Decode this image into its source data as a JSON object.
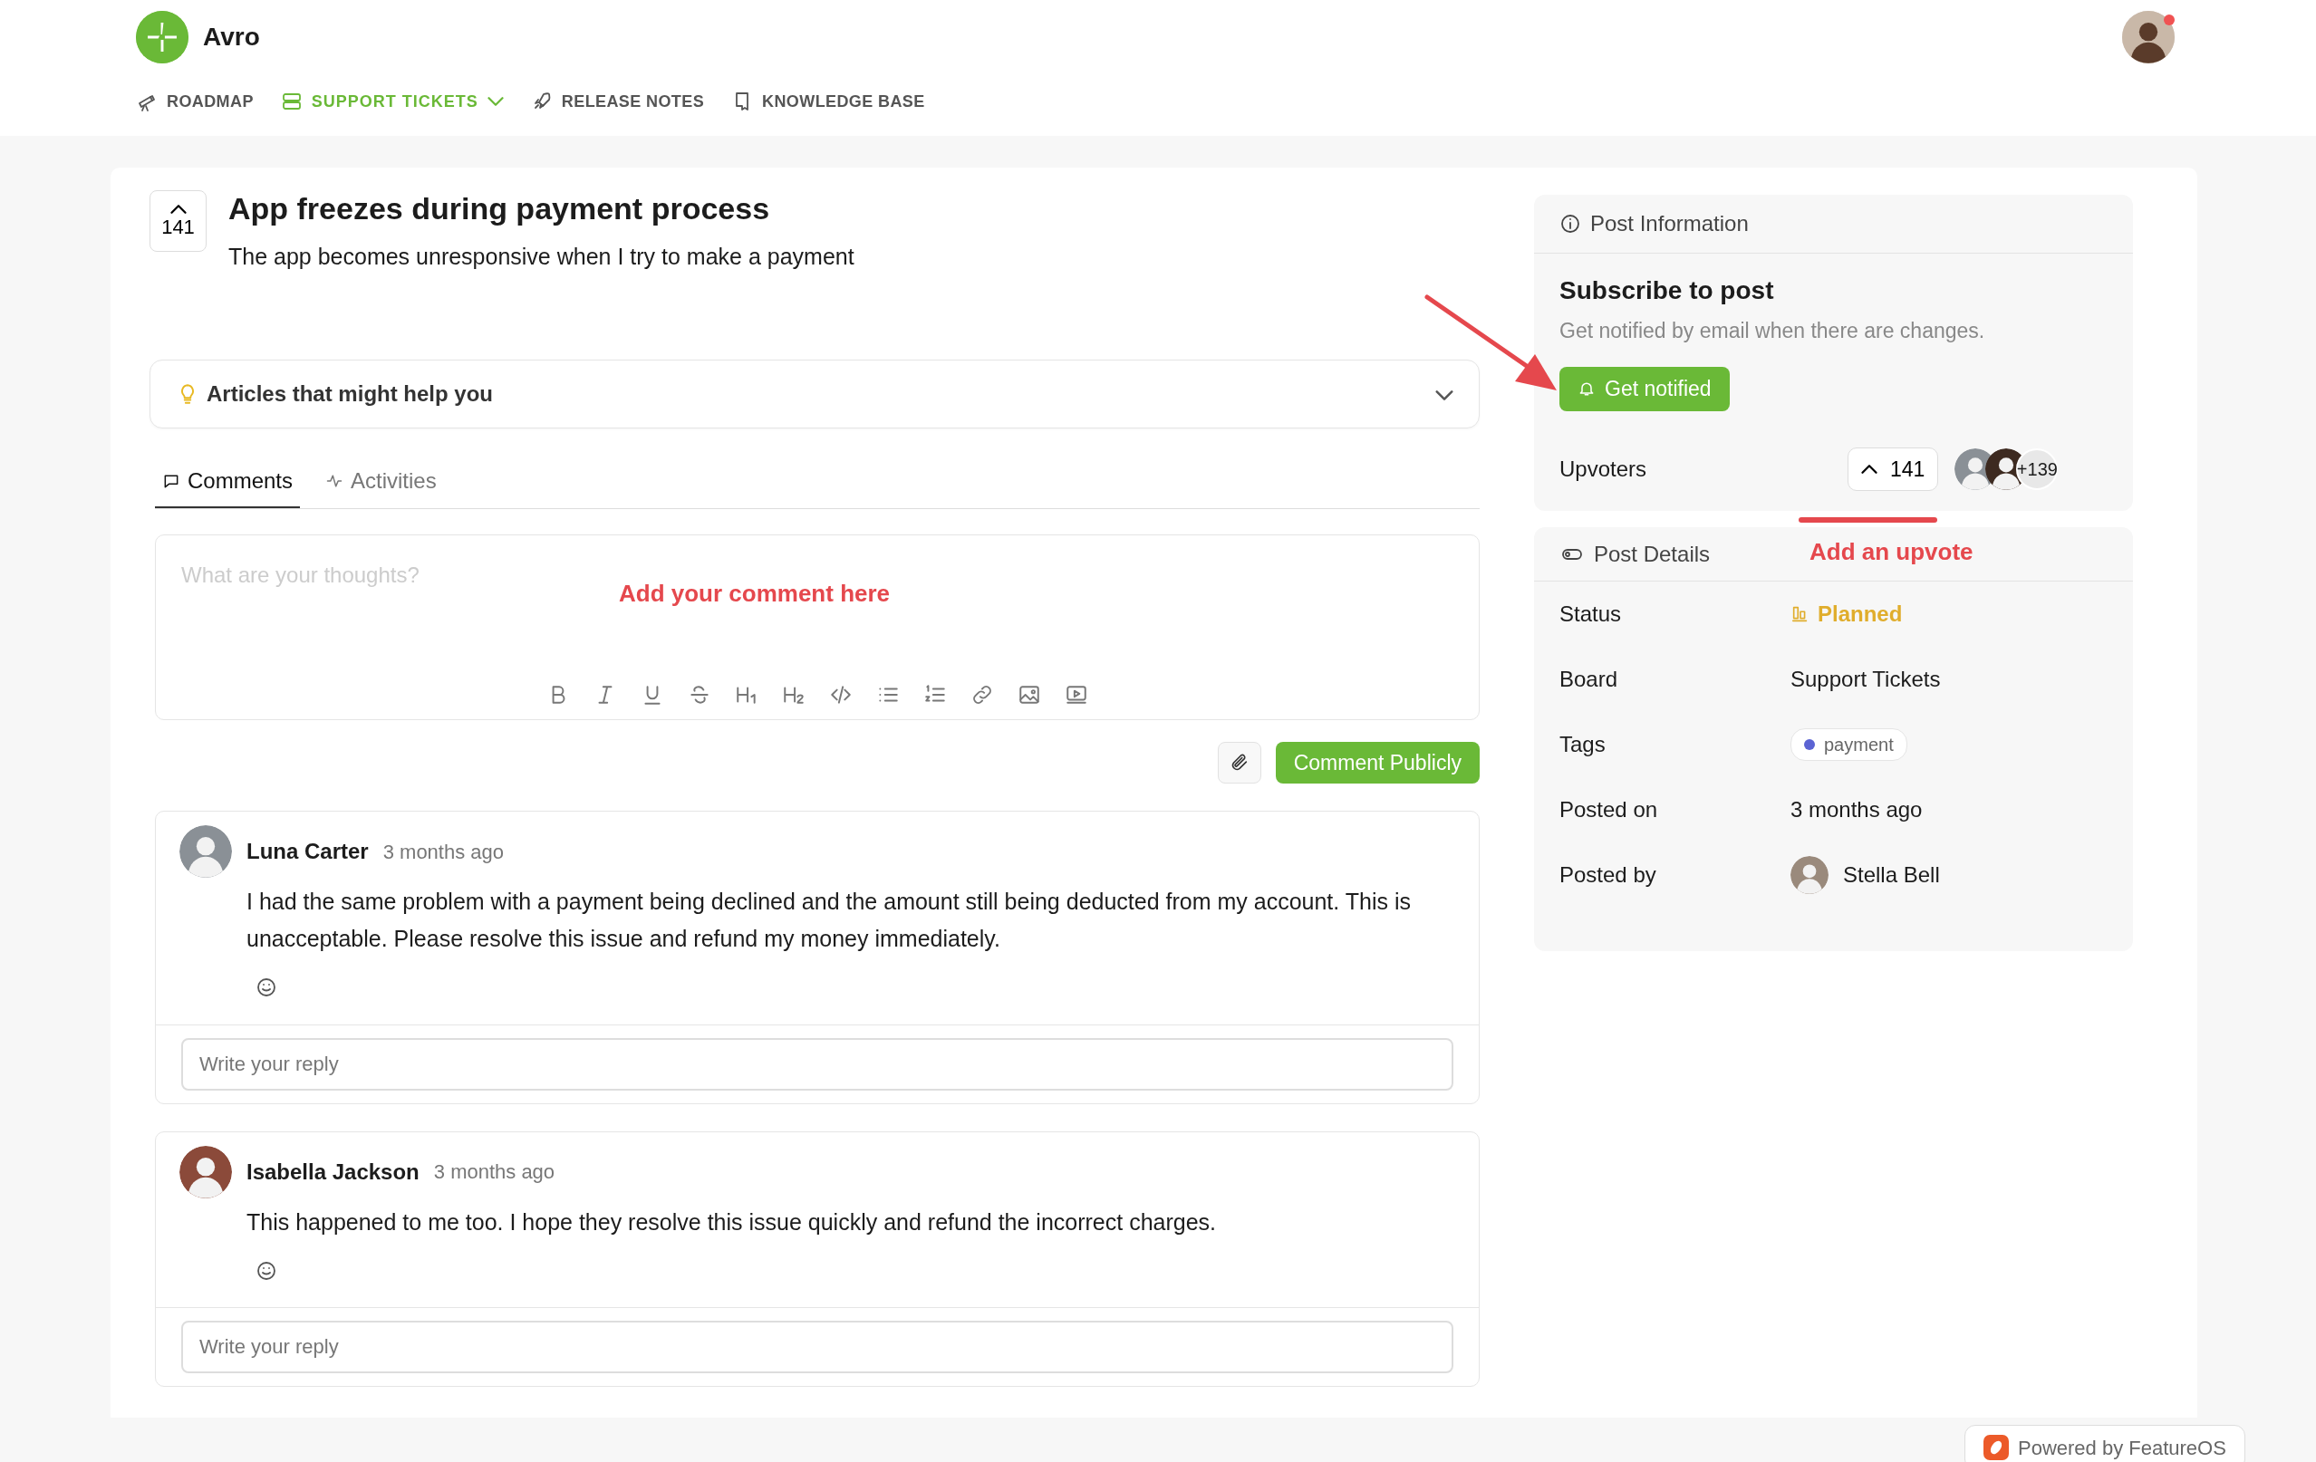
{
  "brand": {
    "name": "Avro"
  },
  "nav": [
    {
      "label": "ROADMAP",
      "selected": false,
      "has_menu": false
    },
    {
      "label": "SUPPORT TICKETS",
      "selected": true,
      "has_menu": true
    },
    {
      "label": "RELEASE NOTES",
      "selected": false,
      "has_menu": false
    },
    {
      "label": "KNOWLEDGE BASE",
      "selected": false,
      "has_menu": false
    }
  ],
  "post": {
    "votes": "141",
    "title": "App freezes during payment process",
    "description": "The app becomes unresponsive when I try to make a payment"
  },
  "articles": {
    "label": "Articles that might help you",
    "expanded": false
  },
  "tabs": [
    {
      "label": "Comments",
      "selected": true
    },
    {
      "label": "Activities",
      "selected": false
    }
  ],
  "editor": {
    "placeholder": "What are your thoughts?",
    "submit": "Comment Publicly"
  },
  "comments": [
    {
      "author": "Luna Carter",
      "time": "3 months ago",
      "text": "I had the same problem with a payment being declined and the amount still being deducted from my account. This is unacceptable. Please resolve this issue and refund my money immediately.",
      "reply_placeholder": "Write your reply"
    },
    {
      "author": "Isabella Jackson",
      "time": "3 months ago",
      "text": "This happened to me too. I hope they resolve this issue quickly and refund the incorrect charges.",
      "reply_placeholder": "Write your reply"
    }
  ],
  "post_information": {
    "title": "Post Information",
    "subscribe_title": "Subscribe to post",
    "subscribe_text": "Get notified by email when there are changes.",
    "button": "Get notified",
    "upvoters_label": "Upvoters",
    "upvote_count": "141",
    "upvoters_more": "+139"
  },
  "post_details": {
    "title": "Post Details",
    "rows": [
      {
        "label": "Status",
        "value": "Planned",
        "kind": "status"
      },
      {
        "label": "Board",
        "value": "Support Tickets",
        "kind": "text"
      },
      {
        "label": "Tags",
        "value": "payment",
        "kind": "tag"
      },
      {
        "label": "Posted on",
        "value": "3 months ago",
        "kind": "text"
      },
      {
        "label": "Posted by",
        "value": "Stella Bell",
        "kind": "user"
      }
    ]
  },
  "annotations": [
    {
      "text": "Add your comment here",
      "kind": "label"
    },
    {
      "text": "Add an upvote",
      "kind": "label"
    },
    {
      "kind": "arrow"
    },
    {
      "kind": "underline"
    }
  ],
  "footer": {
    "powered": "Powered by FeatureOS"
  }
}
